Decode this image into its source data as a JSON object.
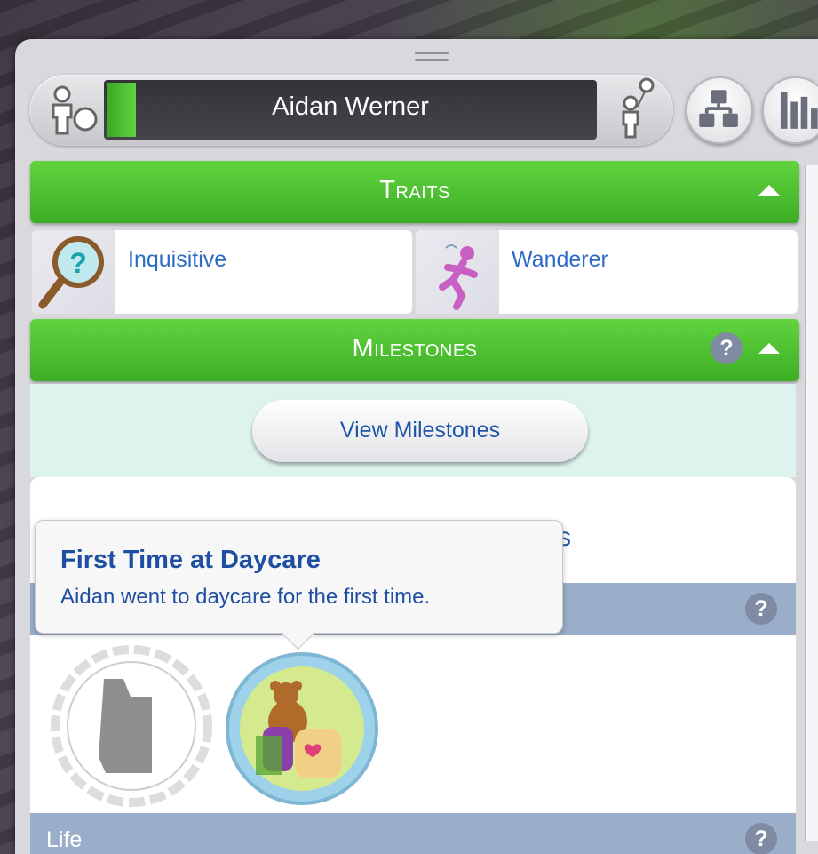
{
  "sim": {
    "name": "Aidan Werner",
    "age_progress": 0.06
  },
  "header_buttons": {
    "family_icon": "family-tree-icon",
    "stats_icon": "bar-chart-icon"
  },
  "traits_section": {
    "title": "Traits",
    "items": [
      {
        "label": "Inquisitive",
        "icon": "magnifier-question-icon"
      },
      {
        "label": "Wanderer",
        "icon": "running-figure-icon"
      }
    ]
  },
  "milestones_section": {
    "title": "Milestones",
    "help": "?",
    "view_button_label": "View Milestones",
    "partial_heading_fragment": "s",
    "life_category": "Life",
    "life_help": "?",
    "tooltip": {
      "title": "First Time at Daycare",
      "description": "Aidan went to daycare for the first time."
    }
  },
  "colors": {
    "section_green": "#4cc12f",
    "link_blue": "#2e6bc7",
    "category_header": "#9aaec9"
  }
}
